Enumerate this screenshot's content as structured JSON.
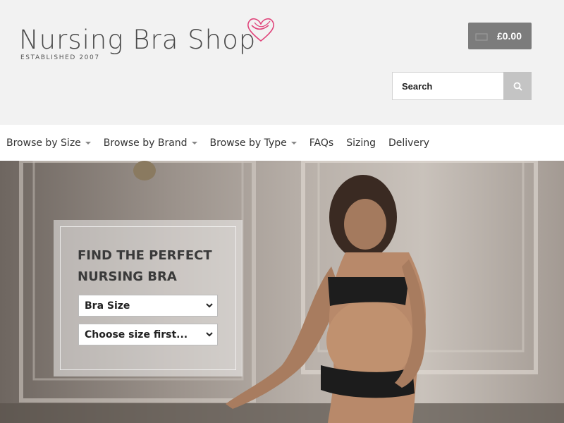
{
  "header": {
    "logo_text": "Nursing Bra Shop",
    "tagline": "ESTABLISHED 2007",
    "brand_color": "#e0457b",
    "cart_total": "£0.00",
    "search_placeholder": "Search"
  },
  "nav": {
    "items": [
      {
        "label": "Browse by Size",
        "dropdown": true
      },
      {
        "label": "Browse by Brand",
        "dropdown": true
      },
      {
        "label": "Browse by Type",
        "dropdown": true
      },
      {
        "label": "FAQs",
        "dropdown": false
      },
      {
        "label": "Sizing",
        "dropdown": false
      },
      {
        "label": "Delivery",
        "dropdown": false
      }
    ]
  },
  "finder": {
    "title": "FIND THE PERFECT NURSING BRA",
    "size_select": "Bra Size",
    "cup_select": "Choose size first..."
  },
  "icons": [
    "heart-logo-icon",
    "basket-icon",
    "search-icon",
    "chevron-down-icon"
  ]
}
